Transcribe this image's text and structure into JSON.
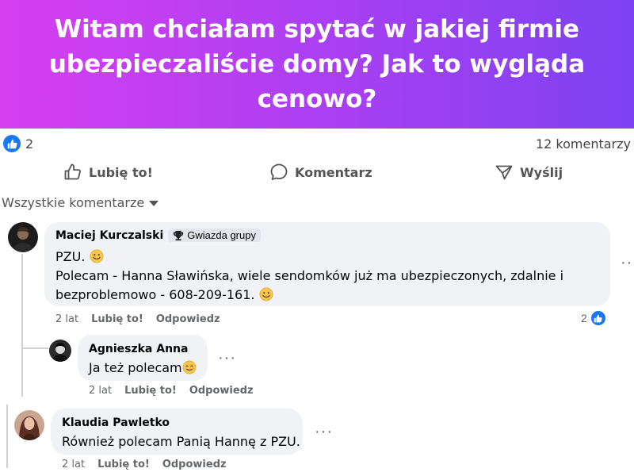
{
  "banner": {
    "title": "Witam chciałam spytać w jakiej firmie ubezpieczaliście domy? Jak to wygląda cenowo?"
  },
  "stats": {
    "likes": "2",
    "comments": "12 komentarzy"
  },
  "actions": {
    "like": "Lubię to!",
    "comment": "Komentarz",
    "share": "Wyślij"
  },
  "filter": {
    "label": "Wszystkie komentarze"
  },
  "comments": [
    {
      "author": "Maciej Kurczalski",
      "badge": "Gwiazda grupy",
      "line1": "PZU.",
      "line2": "Polecam - Hanna Sławińska, wiele sendomków już ma ubezpieczonych, zdalnie i",
      "line3": "bezproblemowo - 608-209-161.",
      "time": "2 lat",
      "like": "Lubię to!",
      "reply": "Odpowiedz",
      "reactions": "2"
    },
    {
      "author": "Agnieszka Anna",
      "text": "Ja też polecam",
      "time": "2 lat",
      "like": "Lubię to!",
      "reply": "Odpowiedz"
    },
    {
      "author": "Klaudia Pawletko",
      "text": "Również polecam Panią Hannę z PZU.",
      "time": "2 lat",
      "like": "Lubię to!",
      "reply": "Odpowiedz"
    }
  ],
  "icons": {
    "like_badge": "thumbs-up-icon",
    "like_action": "thumbs-up-outline-icon",
    "comment_action": "speech-bubble-icon",
    "share_action": "send-icon",
    "badge": "trophy-icon",
    "emoji": "smiley-emoji-icon",
    "more": "more-options-icon"
  },
  "colors": {
    "accent": "#1877f2",
    "banner_start": "#d63ff0",
    "banner_end": "#7d42f2"
  }
}
